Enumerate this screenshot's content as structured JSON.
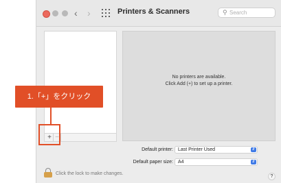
{
  "window": {
    "title": "Printers & Scanners",
    "nav": {
      "back": "‹",
      "forward": "›"
    }
  },
  "search": {
    "placeholder": "Search",
    "icon": "magnifier-icon"
  },
  "printer_list": {
    "add_label": "+",
    "remove_label": "−"
  },
  "empty_state": {
    "line1": "No printers are available.",
    "line2": "Click Add (+) to set up a printer."
  },
  "defaults": {
    "printer_label": "Default printer:",
    "printer_value": "Last Printer Used",
    "paper_label": "Default paper size:",
    "paper_value": "A4"
  },
  "lock": {
    "text": "Click the lock to make changes."
  },
  "help": {
    "label": "?"
  },
  "annotation": {
    "text": "1.「+」をクリック",
    "color": "#e14f27"
  },
  "colors": {
    "accent": "#3f7ae6",
    "close": "#ec6a5e",
    "lock": "#d6a04a"
  }
}
